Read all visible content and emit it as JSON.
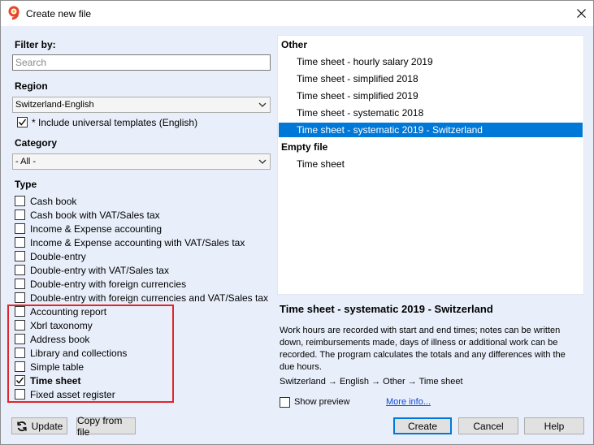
{
  "window": {
    "title": "Create new file"
  },
  "filter": {
    "label": "Filter by:",
    "search_placeholder": "Search",
    "search_value": ""
  },
  "region": {
    "label": "Region",
    "selected": "Switzerland-English",
    "include_universal": {
      "label": "* Include universal templates (English)",
      "checked": true
    }
  },
  "category": {
    "label": "Category",
    "selected": "- All -"
  },
  "type": {
    "label": "Type",
    "items": [
      {
        "label": "Cash book",
        "checked": false,
        "bold": false
      },
      {
        "label": "Cash book with VAT/Sales tax",
        "checked": false,
        "bold": false
      },
      {
        "label": "Income & Expense accounting",
        "checked": false,
        "bold": false
      },
      {
        "label": "Income & Expense accounting with VAT/Sales tax",
        "checked": false,
        "bold": false
      },
      {
        "label": "Double-entry",
        "checked": false,
        "bold": false
      },
      {
        "label": "Double-entry with VAT/Sales tax",
        "checked": false,
        "bold": false
      },
      {
        "label": "Double-entry with foreign currencies",
        "checked": false,
        "bold": false
      },
      {
        "label": "Double-entry with foreign currencies and VAT/Sales tax",
        "checked": false,
        "bold": false
      },
      {
        "label": "Accounting report",
        "checked": false,
        "bold": false
      },
      {
        "label": "Xbrl taxonomy",
        "checked": false,
        "bold": false
      },
      {
        "label": "Address book",
        "checked": false,
        "bold": false
      },
      {
        "label": "Library and collections",
        "checked": false,
        "bold": false
      },
      {
        "label": "Simple table",
        "checked": false,
        "bold": false
      },
      {
        "label": "Time sheet",
        "checked": true,
        "bold": true
      },
      {
        "label": "Fixed asset register",
        "checked": false,
        "bold": false
      }
    ]
  },
  "templates": {
    "groups": [
      {
        "name": "Other",
        "items": [
          {
            "label": "Time sheet - hourly salary 2019",
            "selected": false
          },
          {
            "label": "Time sheet - simplified 2018",
            "selected": false
          },
          {
            "label": "Time sheet - simplified 2019",
            "selected": false
          },
          {
            "label": "Time sheet - systematic 2018",
            "selected": false
          },
          {
            "label": "Time sheet - systematic 2019 - Switzerland",
            "selected": true
          }
        ]
      },
      {
        "name": "Empty file",
        "items": [
          {
            "label": "Time sheet",
            "selected": false
          }
        ]
      }
    ]
  },
  "description": {
    "title": "Time sheet - systematic 2019 - Switzerland",
    "body": "Work hours are recorded with start and end times; notes can be written down, reimbursements made, days of illness or additional work can be recorded. The program calculates the totals and any differences with the due hours.",
    "path": "Switzerland → English → Other → Time sheet"
  },
  "preview": {
    "label": "Show preview",
    "checked": false
  },
  "more_info": "More info...",
  "buttons": {
    "update": "Update",
    "copy_from_file": "Copy from file",
    "create": "Create",
    "cancel": "Cancel",
    "help": "Help"
  },
  "colors": {
    "accent": "#0078d7",
    "highlight_box": "#e0262a",
    "link": "#0b4cd5"
  }
}
